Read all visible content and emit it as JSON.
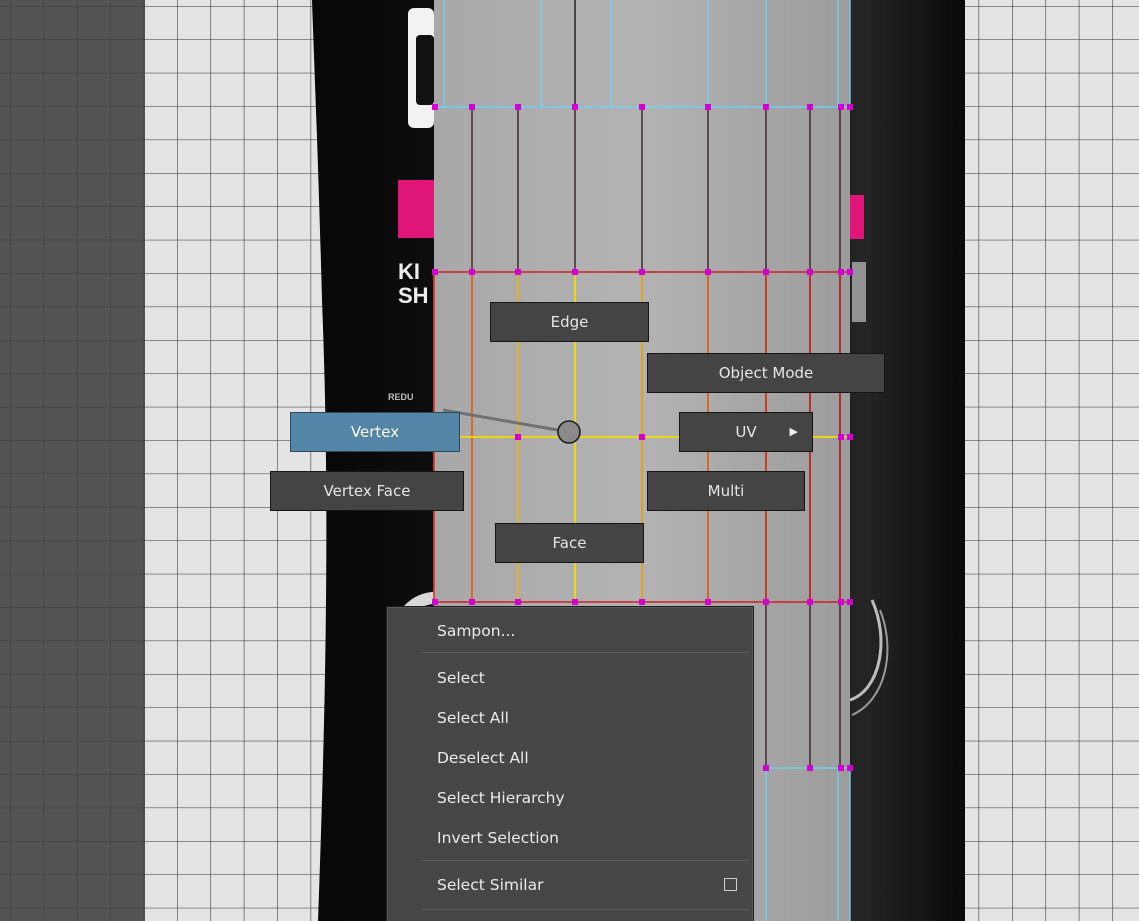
{
  "marking_menu": {
    "items": [
      {
        "id": "edge",
        "label": "Edge"
      },
      {
        "id": "object-mode",
        "label": "Object Mode"
      },
      {
        "id": "vertex",
        "label": "Vertex",
        "active": true
      },
      {
        "id": "uv",
        "label": "UV",
        "submenu_arrow": "▶"
      },
      {
        "id": "vertex-face",
        "label": "Vertex Face"
      },
      {
        "id": "multi",
        "label": "Multi"
      },
      {
        "id": "face",
        "label": "Face"
      }
    ]
  },
  "context_menu": {
    "title": "Sampon...",
    "items": [
      "Select",
      "Select All",
      "Deselect All",
      "Select Hierarchy",
      "Invert Selection"
    ],
    "select_similar": {
      "label": "Select Similar",
      "checkbox": false
    }
  },
  "texture_labels": {
    "line1": "KI",
    "line2": "SH",
    "small": "REDU"
  },
  "colors": {
    "panel_dark": "#545454",
    "grid_bg": "#e4e4e4",
    "menu_bg": "#444444",
    "active": "#5285a6",
    "vertex": "#d400d4",
    "wire_red": "#d02020",
    "wire_yellow": "#f0dd00",
    "uv_border": "#70d0f0",
    "magenta_label": "#e0157a"
  }
}
